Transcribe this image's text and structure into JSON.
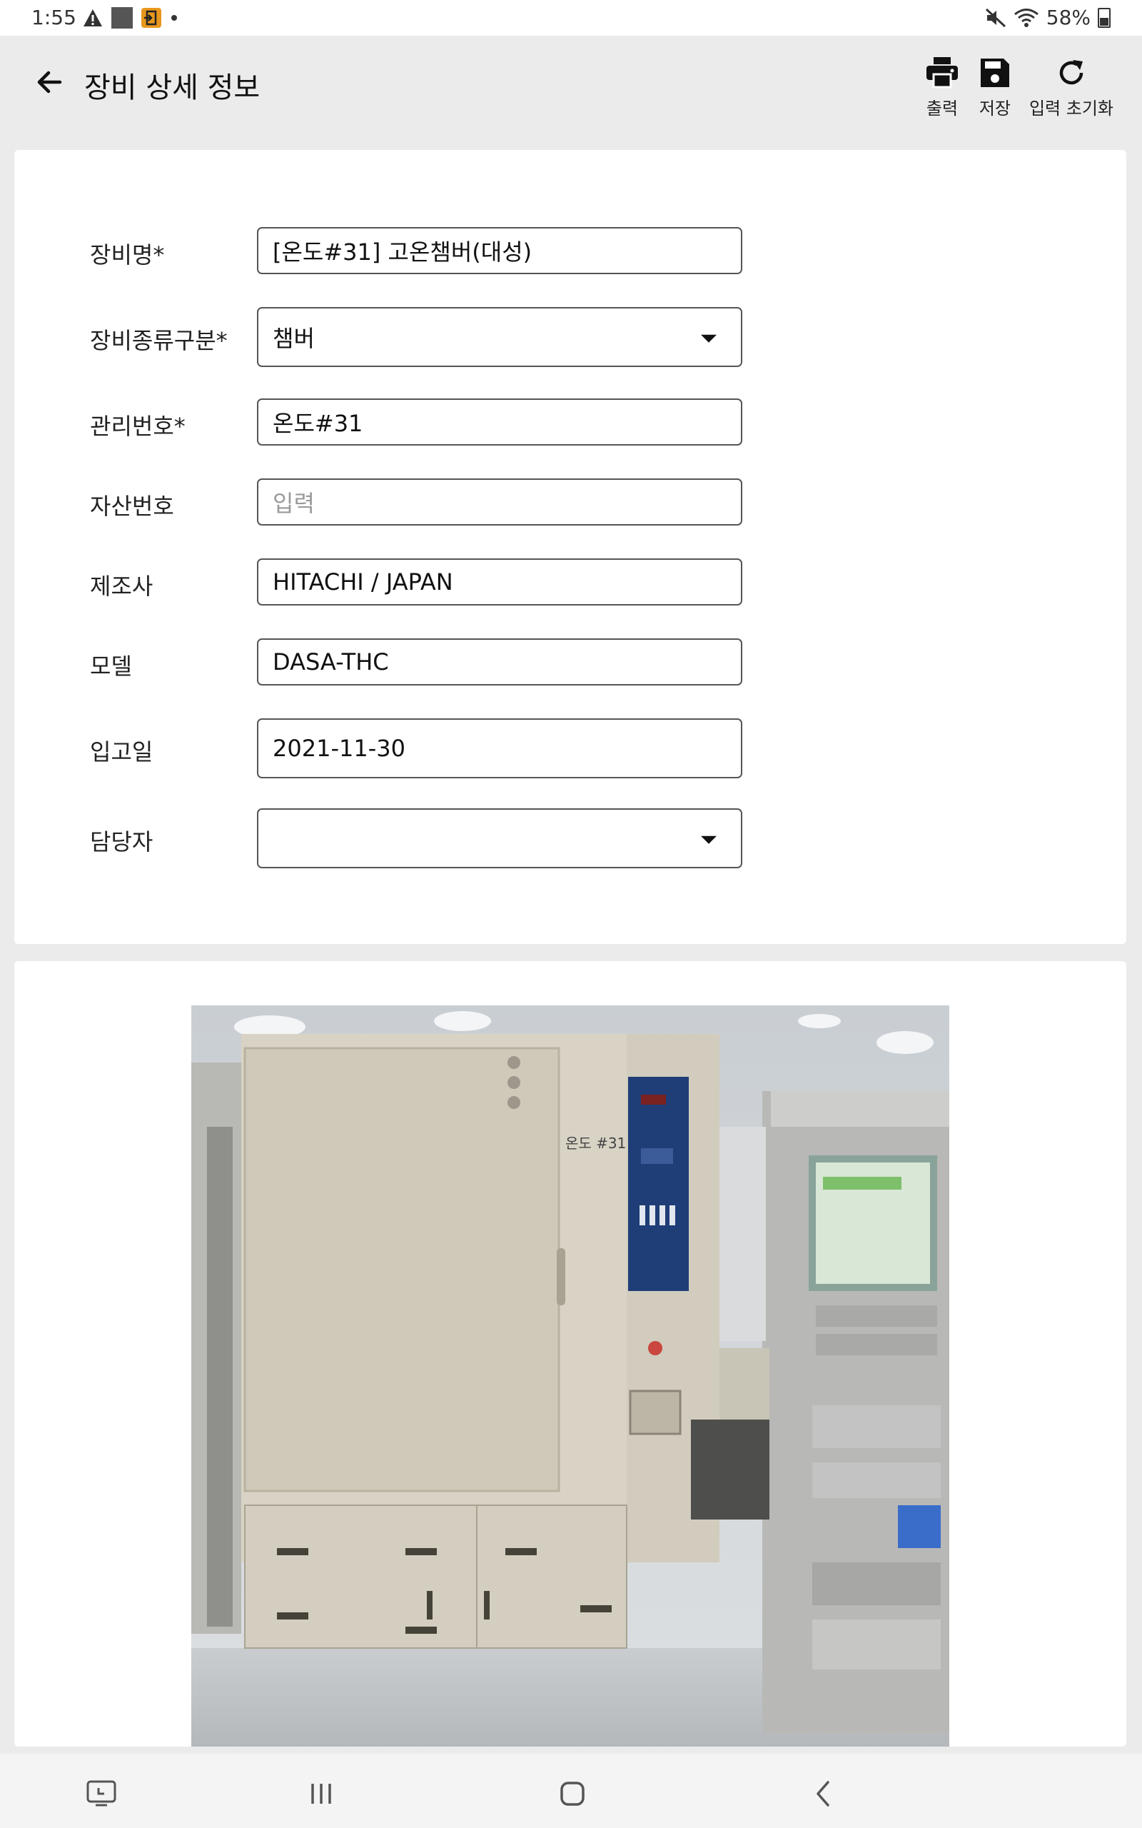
{
  "status_bar": {
    "time": "1:55",
    "battery": "58%",
    "icons": [
      "warning-icon",
      "square-icon",
      "exit-app-icon",
      "dot-icon",
      "mute-icon",
      "wifi-icon",
      "battery-icon"
    ]
  },
  "header": {
    "title": "장비 상세 정보",
    "actions": [
      {
        "label": "출력",
        "icon": "print-icon"
      },
      {
        "label": "저장",
        "icon": "save-icon"
      },
      {
        "label": "입력 초기화",
        "icon": "refresh-icon"
      }
    ]
  },
  "form": {
    "name": {
      "label": "장비명*",
      "value": "[온도#31] 고온챔버(대성)"
    },
    "type": {
      "label": "장비종류구분*",
      "value": "챔버"
    },
    "manage_no": {
      "label": "관리번호*",
      "value": "온도#31"
    },
    "asset_no": {
      "label": "자산번호",
      "value": "",
      "placeholder": "입력"
    },
    "maker": {
      "label": "제조사",
      "value": "HITACHI / JAPAN"
    },
    "model": {
      "label": "모델",
      "value": "DASA-THC"
    },
    "date": {
      "label": "입고일",
      "value": "2021-11-30"
    },
    "manager": {
      "label": "담당자",
      "value": ""
    }
  },
  "photo": {
    "chamber_label": "온도 #31"
  },
  "colors": {
    "background": "#ebebeb",
    "card": "#ffffff",
    "border": "#555555",
    "placeholder": "#9a9a9a"
  },
  "nav_bar": {
    "icons": [
      "recent-screenshot-icon",
      "recents-icon",
      "home-icon",
      "back-nav-icon"
    ]
  }
}
